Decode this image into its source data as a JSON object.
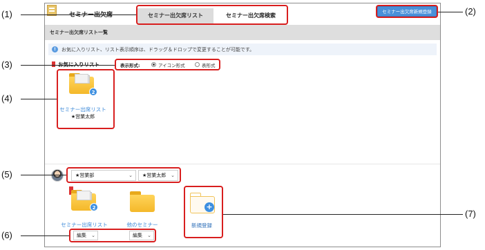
{
  "app": {
    "title": "セミナー出欠席"
  },
  "tabs": [
    {
      "label": "セミナー出欠席リスト"
    },
    {
      "label": "セミナー出欠席検索"
    }
  ],
  "toolbar": {
    "new_button_label": "セミナー出欠席新規登録"
  },
  "section": {
    "title": "セミナー出欠席リスト一覧"
  },
  "info": {
    "message": "お気に入りリスト、リスト表示順序は、ドラッグ＆ドロップで変更することが可能です。"
  },
  "favorites": {
    "label": "お気に入りリスト",
    "display_mode_label": "表示形式:",
    "display_options": [
      {
        "label": "アイコン形式",
        "selected": true
      },
      {
        "label": "表形式",
        "selected": false
      }
    ],
    "items": [
      {
        "name": "セミナー出席リスト",
        "owner": "★営業太郎",
        "badge": "2"
      }
    ]
  },
  "user_section": {
    "department_value": "★営業部",
    "user_value": "★営業太郎",
    "folders": [
      {
        "name": "セミナー出席リスト",
        "badge": "2"
      },
      {
        "name": "他のセミナー"
      }
    ],
    "new_folder_label": "新規登録",
    "edit_labels": [
      "編集",
      "編集"
    ]
  },
  "annotations": [
    "(1)",
    "(2)",
    "(3)",
    "(4)",
    "(5)",
    "(6)",
    "(7)"
  ],
  "colors": {
    "accent": "#4a90d9",
    "highlight": "#d81e1e",
    "link": "#3a88d8",
    "folder": "#f4b82a"
  }
}
